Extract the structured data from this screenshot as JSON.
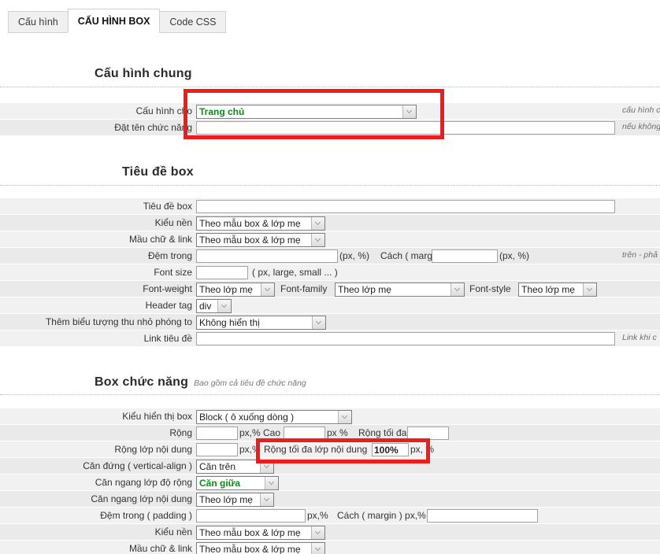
{
  "tabs": [
    {
      "label": "Cấu hình",
      "active": false
    },
    {
      "label": "CẤU HÌNH BOX",
      "active": true
    },
    {
      "label": "Code CSS",
      "active": false
    }
  ],
  "sections": {
    "general": {
      "title": "Cấu hình chung",
      "fields": {
        "config_for_label": "Cấu hình cho",
        "config_for_value": "Trang chủ",
        "config_for_hint": "cấu hình c",
        "name_label": "Đặt tên chức năng",
        "name_value": "",
        "name_hint": "nếu không"
      }
    },
    "boxtitle": {
      "title": "Tiêu đề box",
      "fields": {
        "title_label": "Tiêu đề box",
        "title_value": "",
        "bg_label": "Kiểu nền",
        "bg_value": "Theo mẫu box & lớp mẹ",
        "color_label": "Mầu chữ & link",
        "color_value": "Theo mẫu box & lớp mẹ",
        "padding_label": "Đệm trong",
        "padding_value": "",
        "padding_unit": "(px, %)",
        "margin_label": "Cách ( margin )",
        "margin_value": "",
        "margin_unit": "(px, %)",
        "padding_hint": "trên - phả",
        "fontsize_label": "Font size",
        "fontsize_value": "",
        "fontsize_unit": "( px, large, small ... )",
        "fontweight_label": "Font-weight",
        "fontweight_value": "Theo lớp mẹ",
        "fontfamily_label": "Font-family",
        "fontfamily_value": "Theo lớp mẹ",
        "fontstyle_label": "Font-style",
        "fontstyle_value": "Theo lớp mẹ",
        "headertag_label": "Header tag",
        "headertag_value": "div",
        "zoomicon_label": "Thêm biểu tượng thu nhỏ phóng to",
        "zoomicon_value": "Không hiển thị",
        "link_label": "Link tiêu đề",
        "link_value": "",
        "link_hint": "Link khi c"
      }
    },
    "boxfunc": {
      "title": "Box chức năng",
      "subtitle": "Bao gồm cả tiêu đề chức năng",
      "fields": {
        "display_label": "Kiểu hiển thị box",
        "display_value": "Block ( ô xuống dòng )",
        "width_label": "Rộng",
        "width_value": "",
        "width_unit": "px,%",
        "height_label": "Cao",
        "height_value": "",
        "height_unit": "px %",
        "maxwidth_label": "Rộng tối đa",
        "maxwidth_value": "",
        "contentwidth_label": "Rộng lớp nội dung",
        "contentwidth_value": "",
        "contentwidth_unit": "px,%",
        "contentmax_label": "Rộng tối đa lớp nội dung",
        "contentmax_value": "100%",
        "contentmax_unit": "px, %",
        "valign_label": "Căn đứng ( vertical-align )",
        "valign_value": "Căn trên",
        "halign_width_label": "Căn ngang lớp độ rộng",
        "halign_width_value": "Căn giữa",
        "halign_content_label": "Căn ngang lớp nội dung",
        "halign_content_value": "Theo lớp mẹ",
        "padding_label": "Đệm trong ( padding )",
        "padding_value": "",
        "padding_unit": "px,%",
        "margin_label": "Cách ( margin ) px,%",
        "margin_value": "",
        "bg_label": "Kiểu nền",
        "bg_value": "Theo mẫu box & lớp mẹ",
        "color_label": "Mầu chữ & link",
        "color_value": "Theo mẫu box & lớp mẹ"
      }
    }
  },
  "annotations": {
    "highlight_1": "config-for-row-highlight",
    "highlight_2": "content-max-width-highlight",
    "color": "#ee1c1c"
  }
}
